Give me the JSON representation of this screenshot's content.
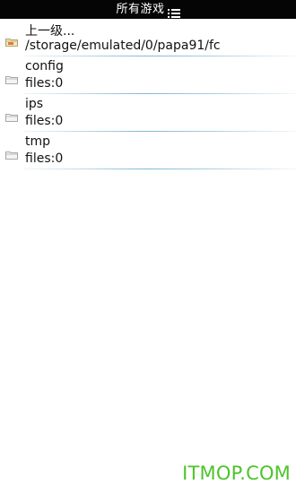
{
  "header": {
    "title": "所有游戏",
    "menu_icon": "menu-list-icon"
  },
  "list": {
    "items": [
      {
        "name": "上一级...",
        "info": "/storage/emulated/0/papa91/fc",
        "icon": "folder-up-icon"
      },
      {
        "name": "config",
        "info": "files:0",
        "icon": "folder-icon"
      },
      {
        "name": "ips",
        "info": "files:0",
        "icon": "folder-icon"
      },
      {
        "name": "tmp",
        "info": "files:0",
        "icon": "folder-icon"
      }
    ]
  },
  "watermark": {
    "text": "ITMOP.COM"
  },
  "colors": {
    "topbar_bg": "#050505",
    "divider": "#7fb8d8",
    "watermark": "#4dc42a"
  }
}
